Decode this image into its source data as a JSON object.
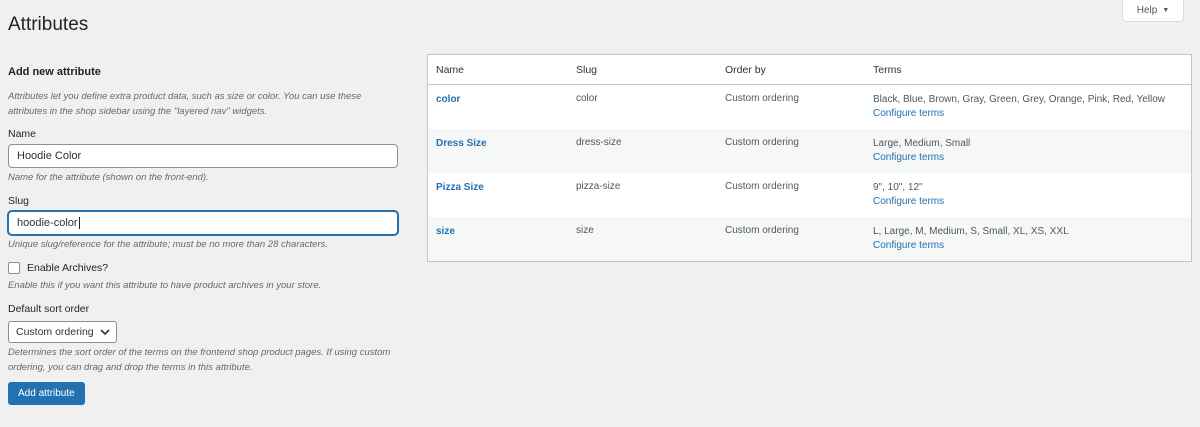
{
  "page": {
    "title": "Attributes",
    "help_label": "Help"
  },
  "form": {
    "heading": "Add new attribute",
    "intro": "Attributes let you define extra product data, such as size or color. You can use these attributes in the shop sidebar using the \"layered nav\" widgets.",
    "name_label": "Name",
    "name_value": "Hoodie Color",
    "name_desc": "Name for the attribute (shown on the front-end).",
    "slug_label": "Slug",
    "slug_value": "hoodie-color",
    "slug_desc": "Unique slug/reference for the attribute; must be no more than 28 characters.",
    "archives_label": "Enable Archives?",
    "archives_checked": false,
    "archives_desc": "Enable this if you want this attribute to have product archives in your store.",
    "sort_label": "Default sort order",
    "sort_value": "Custom ordering",
    "sort_desc": "Determines the sort order of the terms on the frontend shop product pages. If using custom ordering, you can drag and drop the terms in this attribute.",
    "submit_label": "Add attribute"
  },
  "table": {
    "columns": [
      "Name",
      "Slug",
      "Order by",
      "Terms"
    ],
    "rows": [
      {
        "name": "color",
        "slug": "color",
        "order": "Custom ordering",
        "terms": "Black, Blue, Brown, Gray, Green, Grey, Orange, Pink, Red, Yellow",
        "link": "Configure terms"
      },
      {
        "name": "Dress Size",
        "slug": "dress-size",
        "order": "Custom ordering",
        "terms": "Large, Medium, Small",
        "link": "Configure terms"
      },
      {
        "name": "Pizza Size",
        "slug": "pizza-size",
        "order": "Custom ordering",
        "terms": "9\", 10\", 12\"",
        "link": "Configure terms"
      },
      {
        "name": "size",
        "slug": "size",
        "order": "Custom ordering",
        "terms": "L, Large, M, Medium, S, Small, XL, XS, XXL",
        "link": "Configure terms"
      }
    ]
  },
  "colors": {
    "accent": "#2271b1",
    "background": "#f0f0f1"
  }
}
